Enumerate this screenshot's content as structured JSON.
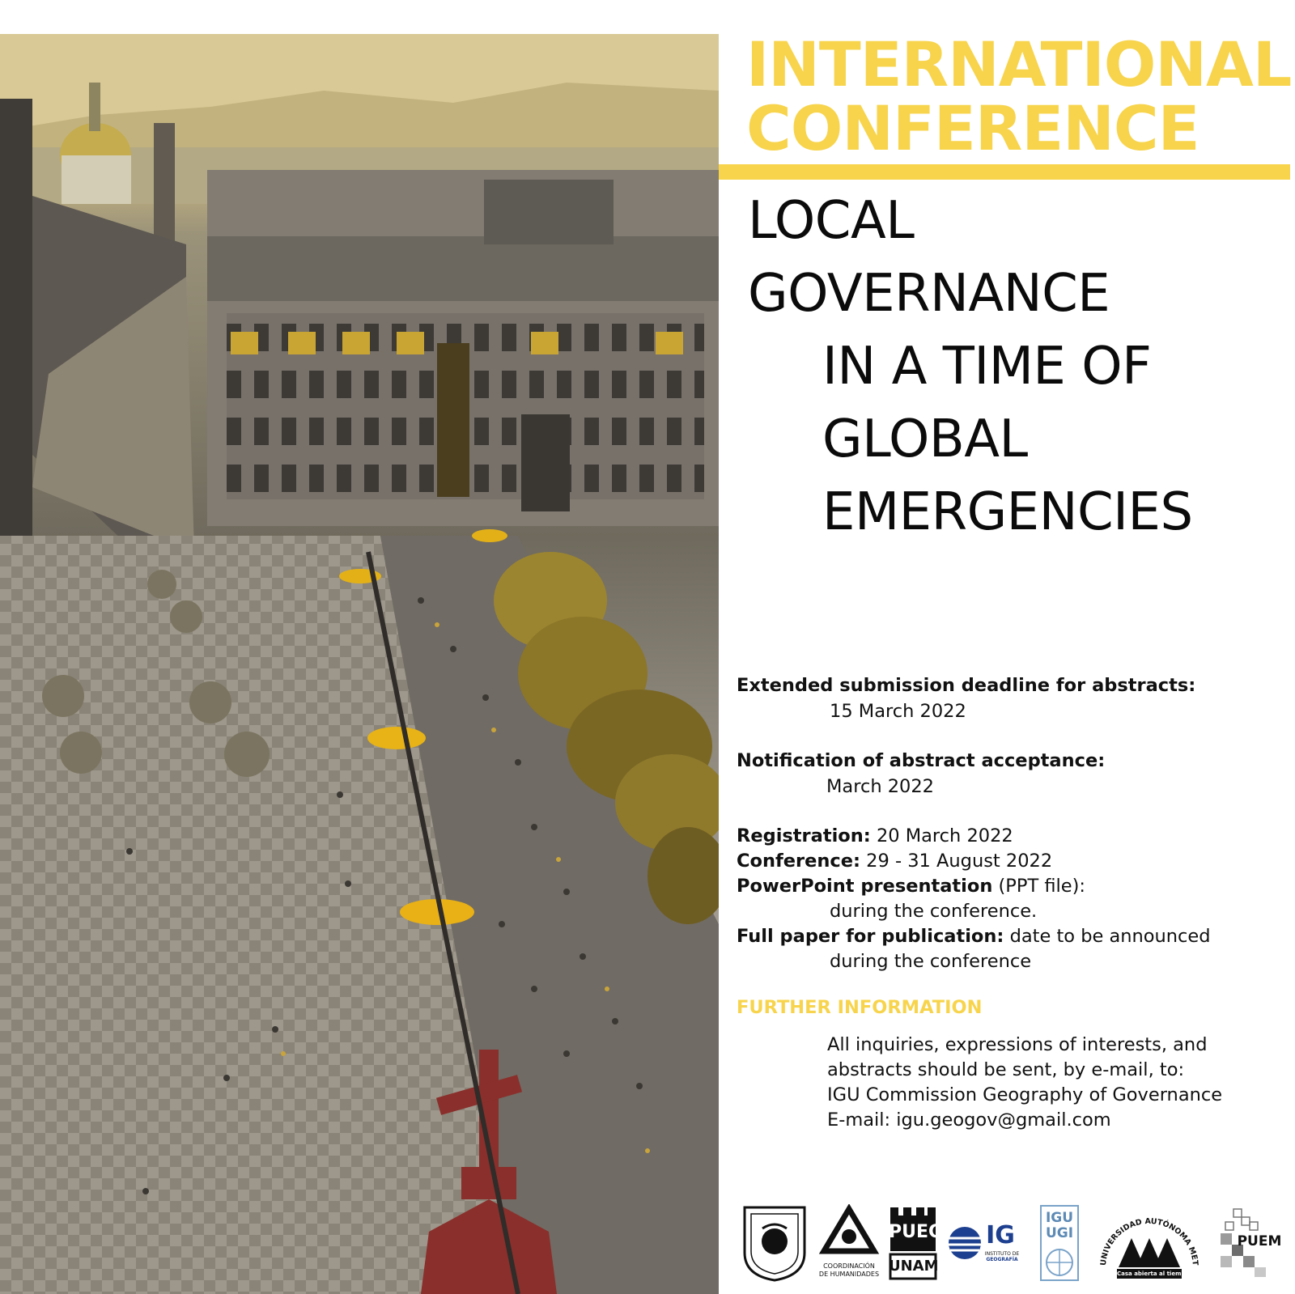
{
  "header": {
    "title_line1": "INTERNATIONAL",
    "title_line2": "CONFERENCE",
    "accent_color": "#f7d44c"
  },
  "subtitle": {
    "line1": "LOCAL",
    "line2": "GOVERNANCE",
    "line3": "IN A TIME OF",
    "line4": "GLOBAL",
    "line5": "EMERGENCIES"
  },
  "dates": {
    "deadline_label": "Extended submission deadline for abstracts:",
    "deadline_value": "15 March 2022",
    "notification_label": "Notification of abstract acceptance:",
    "notification_value": "March 2022",
    "registration_label": "Registration:",
    "registration_value": "20 March 2022",
    "conference_label": "Conference:",
    "conference_value": "29 - 31 August 2022",
    "ppt_label": "PowerPoint presentation",
    "ppt_value": "(PPT file):",
    "ppt_detail": "during the conference.",
    "paper_label": "Full paper for publication:",
    "paper_value": "date to be announced",
    "paper_detail": "during the conference"
  },
  "further": {
    "heading": "FURTHER INFORMATION",
    "line1": "All inquiries, expressions of interests, and",
    "line2": "abstracts should be sent, by e-mail, to:",
    "line3": "IGU Commission Geography of Governance",
    "line4": "E-mail: igu.geogov@gmail.com"
  },
  "logos": {
    "coordinacion_line1": "COORDINACIÓN",
    "coordinacion_line2": "DE HUMANIDADES",
    "puec_top": "PUEC",
    "puec_bottom": "UNAM",
    "ig": "IG",
    "ig_caption_line1": "INSTITUTO DE",
    "ig_caption_line2": "GEOGRAFÍA",
    "igu_top": "IGU",
    "igu_bottom": "UGI",
    "uam_arc": "UNIVERSIDAD AUTÓNOMA METROPOLITANA",
    "uam_tagline": "Casa abierta al tiempo",
    "puem": "PUEM"
  }
}
